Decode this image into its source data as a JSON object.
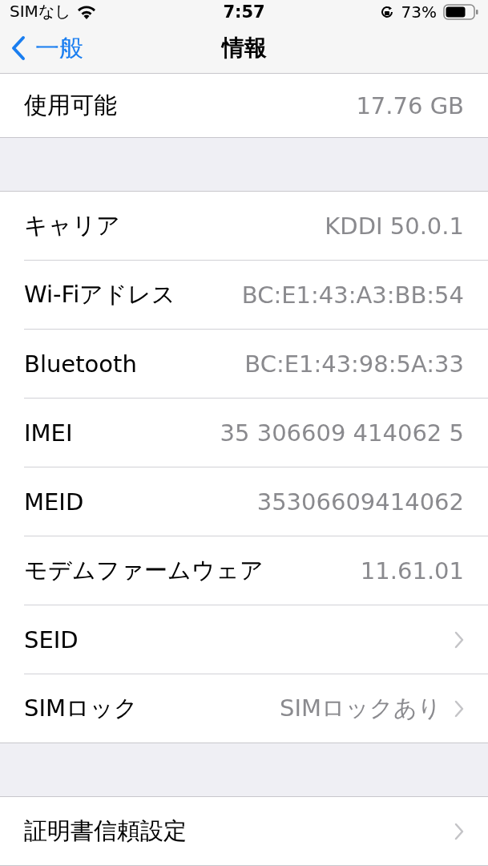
{
  "status_bar": {
    "carrier": "SIMなし",
    "time": "7:57",
    "battery": "73%"
  },
  "nav": {
    "back": "一般",
    "title": "情報"
  },
  "groups": [
    {
      "rows": [
        {
          "label": "使用可能",
          "value": "17.76 GB",
          "chevron": false
        }
      ]
    },
    {
      "rows": [
        {
          "label": "キャリア",
          "value": "KDDI 50.0.1",
          "chevron": false
        },
        {
          "label": "Wi-Fiアドレス",
          "value": "BC:E1:43:A3:BB:54",
          "chevron": false
        },
        {
          "label": "Bluetooth",
          "value": "BC:E1:43:98:5A:33",
          "chevron": false
        },
        {
          "label": "IMEI",
          "value": "35 306609 414062 5",
          "chevron": false
        },
        {
          "label": "MEID",
          "value": "35306609414062",
          "chevron": false
        },
        {
          "label": "モデムファームウェア",
          "value": "11.61.01",
          "chevron": false
        },
        {
          "label": "SEID",
          "chevron": true
        },
        {
          "label": "SIMロック",
          "value": "SIMロックあり",
          "chevron": true
        }
      ]
    },
    {
      "rows": [
        {
          "label": "証明書信頼設定",
          "chevron": true
        }
      ]
    }
  ]
}
